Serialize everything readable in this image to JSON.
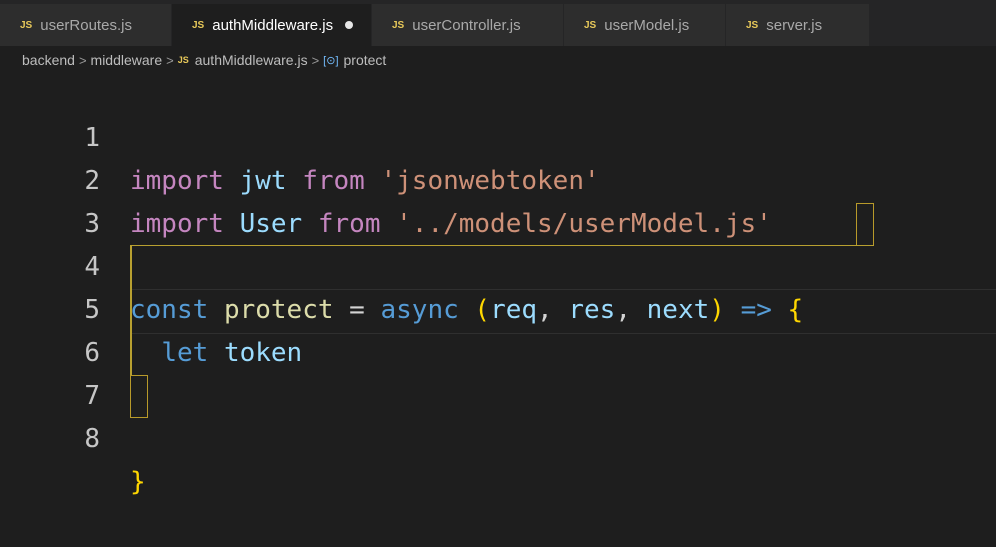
{
  "tabs": [
    {
      "label": "userRoutes.js",
      "icon": "js-file-icon",
      "active": false,
      "dirty": false
    },
    {
      "label": "authMiddleware.js",
      "icon": "js-file-icon",
      "active": true,
      "dirty": true
    },
    {
      "label": "userController.js",
      "icon": "js-file-icon",
      "active": false,
      "dirty": false
    },
    {
      "label": "userModel.js",
      "icon": "js-file-icon",
      "active": false,
      "dirty": false
    },
    {
      "label": "server.js",
      "icon": "js-file-icon",
      "active": false,
      "dirty": false
    }
  ],
  "js_badge": "JS",
  "breadcrumb": {
    "items": [
      "backend",
      "middleware",
      "authMiddleware.js",
      "protect"
    ],
    "symbol_icon": "[⊙]"
  },
  "editor": {
    "line_numbers": [
      "1",
      "2",
      "3",
      "4",
      "5",
      "6",
      "7",
      "8"
    ],
    "line1": {
      "import": "import",
      "name": "jwt",
      "from": "from",
      "str": "'jsonwebtoken'"
    },
    "line2": {
      "import": "import",
      "name": "User",
      "from": "from",
      "str": "'../models/userModel.js'"
    },
    "line4": {
      "const": "const",
      "name": "protect",
      "eq": "=",
      "async": "async",
      "lparen": "(",
      "p1": "req",
      "c1": ",",
      "p2": "res",
      "c2": ",",
      "p3": "next",
      "rparen": ")",
      "arrow": "=>",
      "lbrace": "{"
    },
    "line5": {
      "let": "let",
      "name": "token"
    },
    "line8": {
      "rbrace": "}"
    }
  },
  "colors": {
    "keyword_purple": "#c586c0",
    "keyword_blue": "#569cd6",
    "variable": "#9cdcfe",
    "function": "#dcdcaa",
    "string": "#ce9178",
    "bracket_gold": "#ffd700",
    "js_icon": "#e8c95a"
  }
}
